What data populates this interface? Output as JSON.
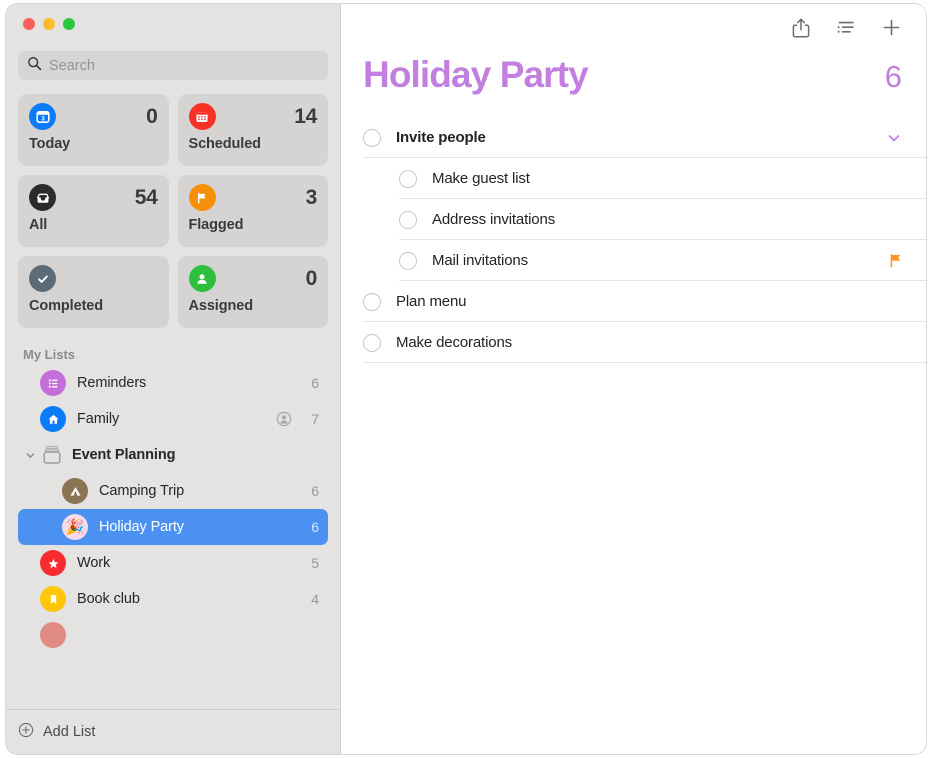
{
  "window": {
    "traffic_lights": [
      "close",
      "minimize",
      "zoom"
    ],
    "colors": {
      "accent_purple": "#C27FDF",
      "selection_blue": "#4B91F1",
      "sidebar_bg": "#E4E3E1",
      "flag_orange": "#FB9327"
    }
  },
  "sidebar": {
    "search": {
      "placeholder": "Search",
      "value": "",
      "icon": "search-icon"
    },
    "smart_lists": [
      {
        "label": "Today",
        "count": "0",
        "icon": "calendar-today-icon",
        "badge_color": "#0A7CF7"
      },
      {
        "label": "Scheduled",
        "count": "14",
        "icon": "calendar-icon",
        "badge_color": "#F73125"
      },
      {
        "label": "All",
        "count": "54",
        "icon": "inbox-tray-icon",
        "badge_color": "#2B2B2B"
      },
      {
        "label": "Flagged",
        "count": "3",
        "icon": "flag-icon",
        "badge_color": "#F79009"
      },
      {
        "label": "Completed",
        "count": "",
        "icon": "checkmark-icon",
        "badge_color": "#5C6B78"
      },
      {
        "label": "Assigned",
        "count": "0",
        "icon": "person-icon",
        "badge_color": "#2DC03C"
      }
    ],
    "my_lists_header": "My Lists",
    "lists": [
      {
        "name": "Reminders",
        "count": "6",
        "icon": "list-lines-icon",
        "icon_color": "#C46FD9",
        "shared": false,
        "selected": false,
        "indented": false
      },
      {
        "name": "Family",
        "count": "7",
        "icon": "house-icon",
        "icon_color": "#0A7CF7",
        "shared": true,
        "selected": false,
        "indented": false
      }
    ],
    "group": {
      "name": "Event Planning",
      "icon": "folder-group-icon",
      "chevron": "chevron-down-icon",
      "expanded": true,
      "children": [
        {
          "name": "Camping Trip",
          "count": "6",
          "icon": "tent-icon",
          "icon_color": "#8B7355",
          "selected": false
        },
        {
          "name": "Holiday Party",
          "count": "6",
          "icon": "party-popper-icon",
          "icon_color": "#F6DCEA",
          "selected": true
        }
      ]
    },
    "lists_after": [
      {
        "name": "Work",
        "count": "5",
        "icon": "star-icon",
        "icon_color": "#F62C30",
        "shared": false,
        "selected": false
      },
      {
        "name": "Book club",
        "count": "4",
        "icon": "bookmark-icon",
        "icon_color": "#FFC60A",
        "shared": false,
        "selected": false
      }
    ],
    "partial_list": {
      "name": "",
      "count": "",
      "icon_color": "#E08C84"
    },
    "add_list": {
      "label": "Add List",
      "icon": "plus-circle-icon"
    }
  },
  "main": {
    "toolbar": [
      {
        "name": "share",
        "icon": "share-icon"
      },
      {
        "name": "view-options",
        "icon": "list-format-icon"
      },
      {
        "name": "add-reminder",
        "icon": "plus-icon"
      }
    ],
    "title": "Holiday Party",
    "count": "6",
    "reminders": [
      {
        "text": "Invite people",
        "level": "parent",
        "chevron": "chevron-down-icon",
        "flagged": false,
        "completed": false
      },
      {
        "text": "Make guest list",
        "level": "child",
        "chevron": "",
        "flagged": false,
        "completed": false
      },
      {
        "text": "Address invitations",
        "level": "child",
        "chevron": "",
        "flagged": false,
        "completed": false
      },
      {
        "text": "Mail invitations",
        "level": "child",
        "chevron": "",
        "flagged": true,
        "completed": false
      },
      {
        "text": "Plan menu",
        "level": "parent",
        "chevron": "",
        "flagged": false,
        "completed": false
      },
      {
        "text": "Make decorations",
        "level": "parent",
        "chevron": "",
        "flagged": false,
        "completed": false
      }
    ]
  }
}
